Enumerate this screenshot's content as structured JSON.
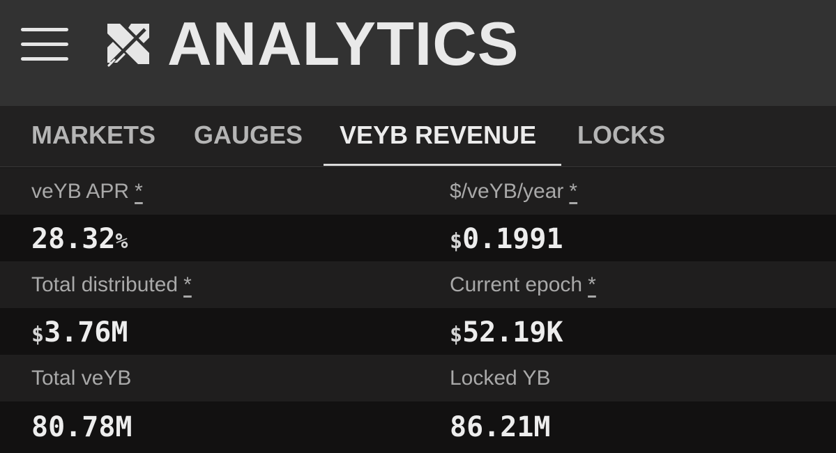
{
  "header": {
    "title": "ANALYTICS",
    "menu_icon": "hamburger-menu-icon",
    "logo_icon": "logo-icon"
  },
  "tabs": [
    {
      "label": "MARKETS",
      "active": false
    },
    {
      "label": "GAUGES",
      "active": false
    },
    {
      "label": "VEYB REVENUE",
      "active": true
    },
    {
      "label": "LOCKS",
      "active": false
    }
  ],
  "stats": {
    "apr": {
      "label": "veYB APR",
      "info": "*",
      "value": "28.32",
      "suffix": "%"
    },
    "per_veyb_year": {
      "label": "$/veYB/year",
      "info": "*",
      "prefix": "$",
      "value": "0.1991"
    },
    "total_distributed": {
      "label": "Total distributed",
      "info": "*",
      "prefix": "$",
      "value": "3.76M"
    },
    "current_epoch": {
      "label": "Current epoch",
      "info": "*",
      "prefix": "$",
      "value": "52.19K"
    },
    "total_veyb": {
      "label": "Total veYB",
      "value": "80.78M"
    },
    "locked_yb": {
      "label": "Locked YB",
      "value": "86.21M"
    }
  },
  "colors": {
    "header_bg": "#323232",
    "tabs_bg": "#222121",
    "label_row_bg": "#1f1e1e",
    "value_row_bg": "#121111",
    "text_primary": "#ededed",
    "text_muted": "#a9a9a9"
  }
}
